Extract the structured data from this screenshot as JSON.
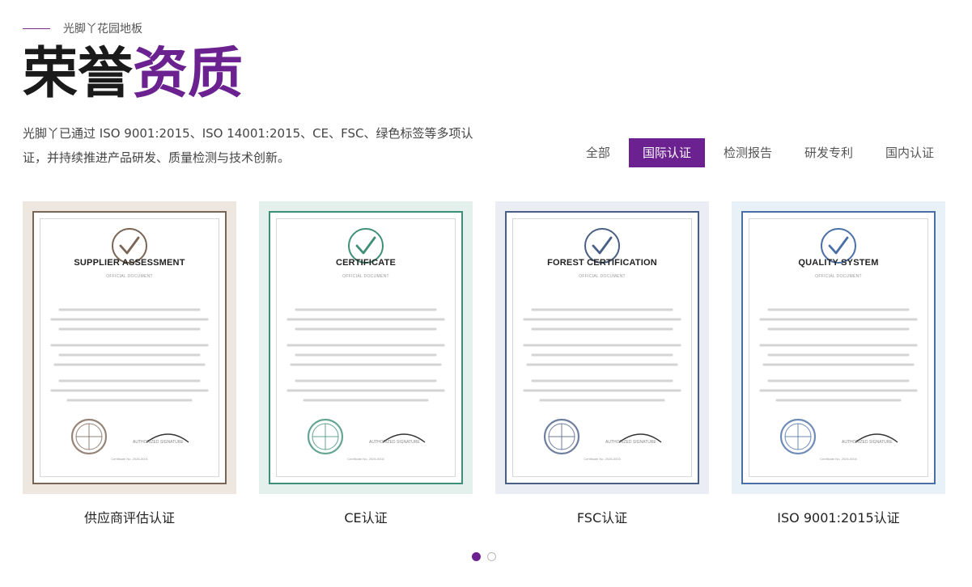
{
  "header": {
    "brand": "光脚丫花园地板",
    "title_part1": "荣誉",
    "title_part2": "资质",
    "description": "光脚丫已通过 ISO 9001:2015、ISO 14001:2015、CE、FSC、绿色标签等多项认证，并持续推进产品研发、质量检测与技术创新。"
  },
  "tabs": [
    {
      "label": "全部",
      "active": false
    },
    {
      "label": "国际认证",
      "active": true
    },
    {
      "label": "检测报告",
      "active": false
    },
    {
      "label": "研发专利",
      "active": false
    },
    {
      "label": "国内认证",
      "active": false
    }
  ],
  "cards": [
    {
      "label": "供应商评估认证",
      "cert_title": "SUPPLIER ASSESSMENT",
      "cert_sub": "OFFICIAL DOCUMENT",
      "sig_label": "AUTHORIZED SIGNATURE",
      "cert_no": "Certificate No. 2026-0001",
      "bg": "#ede7df",
      "accent": "#7a6555"
    },
    {
      "label": "CE认证",
      "cert_title": "CERTIFICATE",
      "cert_sub": "OFFICIAL DOCUMENT",
      "sig_label": "AUTHORIZED SIGNATURE",
      "cert_no": "Certificate No. 2026-0002",
      "bg": "#e4f0ec",
      "accent": "#3f8f78"
    },
    {
      "label": "FSC认证",
      "cert_title": "FOREST CERTIFICATION",
      "cert_sub": "OFFICIAL DOCUMENT",
      "sig_label": "AUTHORIZED SIGNATURE",
      "cert_no": "Certificate No. 2026-0003",
      "bg": "#eaedf3",
      "accent": "#4a5f86"
    },
    {
      "label": "ISO 9001:2015认证",
      "cert_title": "QUALITY SYSTEM",
      "cert_sub": "OFFICIAL DOCUMENT",
      "sig_label": "AUTHORIZED SIGNATURE",
      "cert_no": "Certificate No. 2026-0004",
      "bg": "#e8f0f8",
      "accent": "#4a6fa5"
    }
  ],
  "pagination": {
    "active_index": 0,
    "count": 2
  },
  "colors": {
    "brand_purple": "#6b2290",
    "title_dark": "#1a1a1a"
  }
}
